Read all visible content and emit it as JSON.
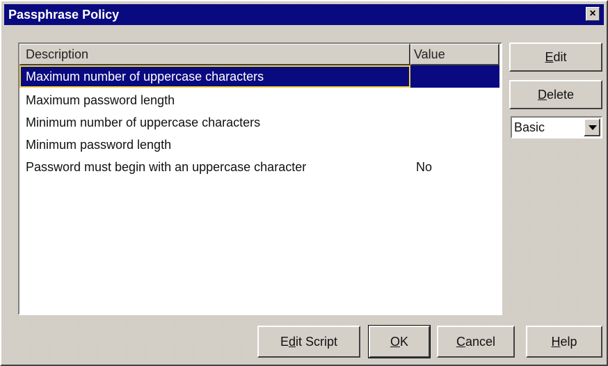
{
  "window": {
    "title": "Passphrase Policy",
    "close_label": "×"
  },
  "table": {
    "columns": [
      "Description",
      "Value"
    ],
    "rows": [
      {
        "description": "Maximum number of uppercase characters",
        "value": ""
      },
      {
        "description": "Maximum password length",
        "value": ""
      },
      {
        "description": "Minimum number of uppercase characters",
        "value": ""
      },
      {
        "description": "Minimum password length",
        "value": ""
      },
      {
        "description": "Password must begin with an uppercase character",
        "value": "No"
      }
    ],
    "selected_row": 0
  },
  "side_buttons": {
    "edit": {
      "pre": "",
      "mnemonic": "E",
      "post": "dit"
    },
    "delete": {
      "pre": "",
      "mnemonic": "D",
      "post": "elete"
    }
  },
  "mode_select": {
    "value": "Basic"
  },
  "bottom_buttons": {
    "edit_script": {
      "pre": "E",
      "mnemonic": "d",
      "post": "it Script"
    },
    "ok": {
      "pre": "",
      "mnemonic": "O",
      "post": "K"
    },
    "cancel": {
      "pre": "",
      "mnemonic": "C",
      "post": "ancel"
    },
    "help": {
      "pre": "",
      "mnemonic": "H",
      "post": "elp"
    }
  },
  "colors": {
    "face": "#d4d0c8",
    "titlebar": "#0a0a80",
    "selection": "#0a0a80",
    "focus_border": "#f0d048"
  }
}
